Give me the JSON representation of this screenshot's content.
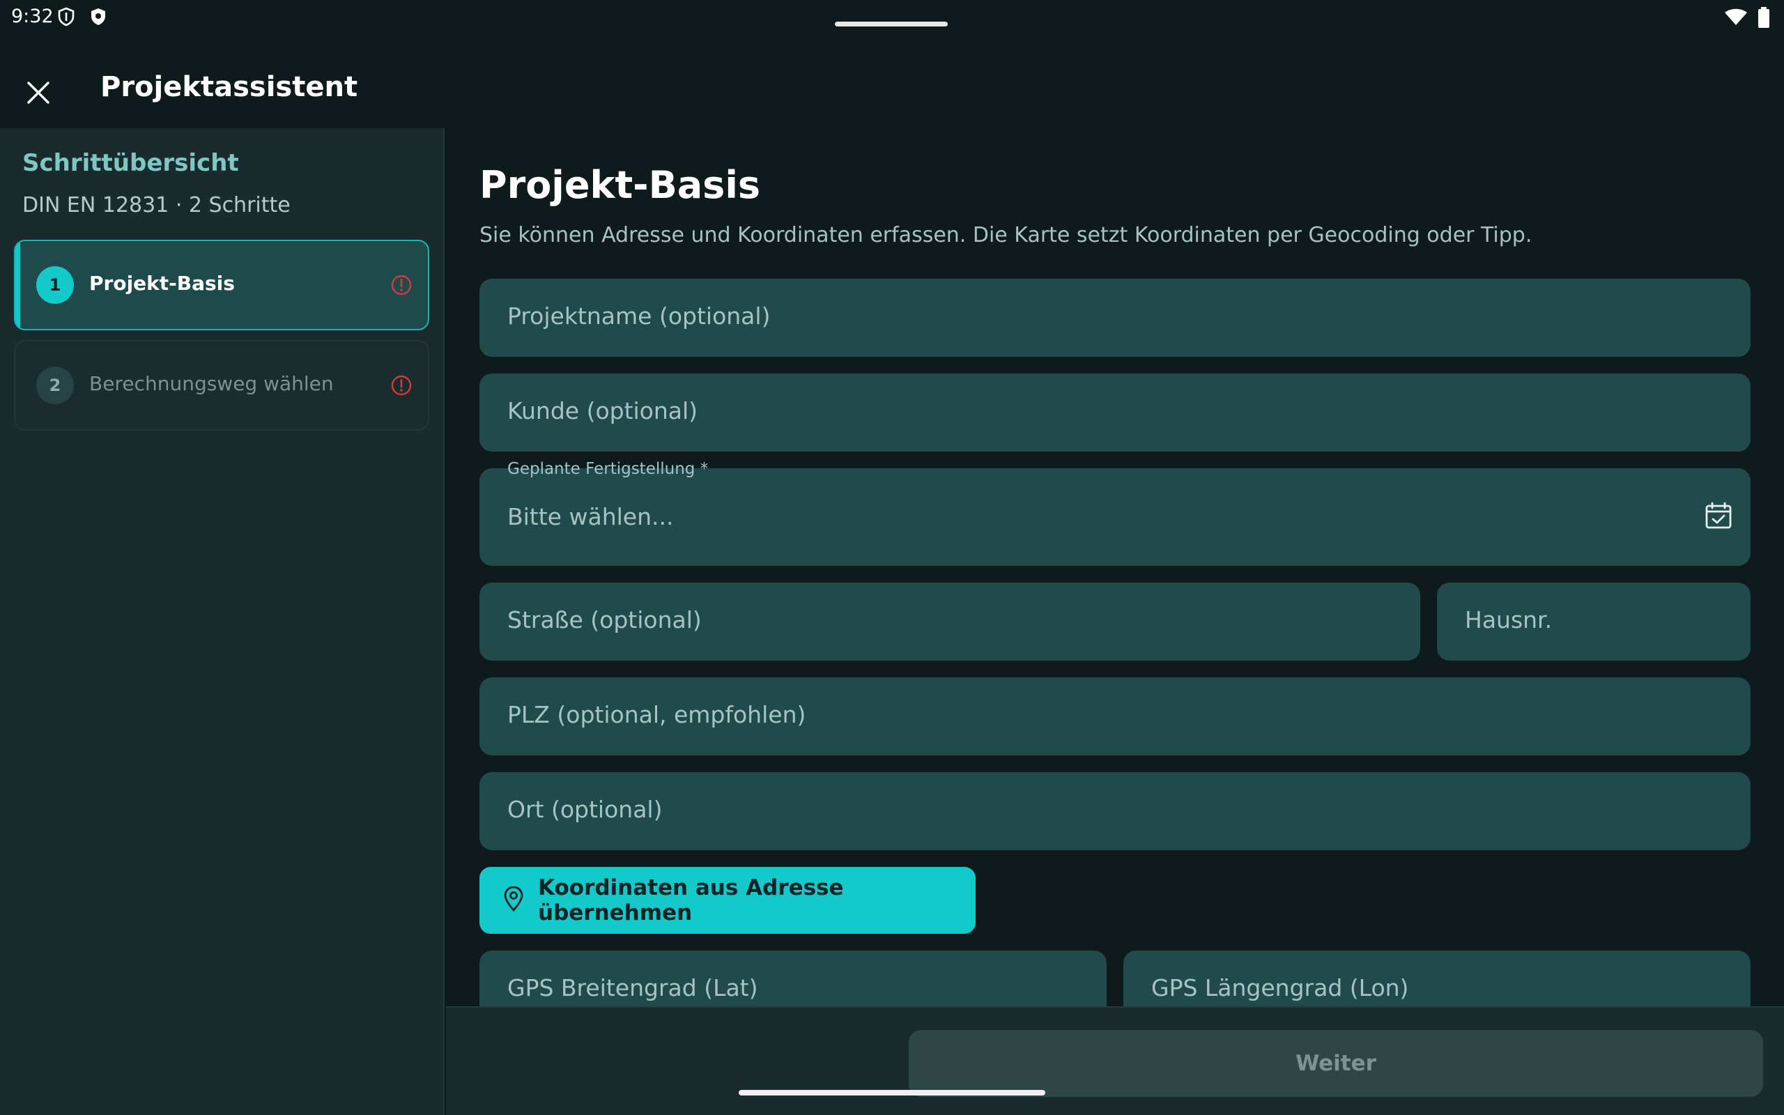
{
  "status": {
    "time": "9:32",
    "left_icons": [
      "shield-outline-icon",
      "shield-check-icon"
    ],
    "right_icons": [
      "wifi-icon",
      "battery-icon"
    ]
  },
  "appbar": {
    "close_icon": "close-icon",
    "title": "Projektassistent"
  },
  "sidebar": {
    "title": "Schrittübersicht",
    "subtitle": "DIN EN 12831 · 2 Schritte",
    "steps": [
      {
        "number": "1",
        "label": "Projekt-Basis",
        "active": true,
        "warning_icon": "error-circle-icon"
      },
      {
        "number": "2",
        "label": "Berechnungsweg wählen",
        "active": false,
        "warning_icon": "error-circle-icon"
      }
    ]
  },
  "main": {
    "title": "Projekt-Basis",
    "description": "Sie können Adresse und Koordinaten erfassen. Die Karte setzt Koordinaten per Geocoding oder Tipp.",
    "fields": {
      "project_name": {
        "placeholder": "Projektname (optional)"
      },
      "customer": {
        "placeholder": "Kunde (optional)"
      },
      "completion": {
        "label": "Geplante Fertigstellung *",
        "placeholder": "Bitte wählen...",
        "icon": "calendar-check-icon"
      },
      "street": {
        "placeholder": "Straße (optional)"
      },
      "house_number": {
        "placeholder": "Hausnr."
      },
      "zip": {
        "placeholder": "PLZ (optional, empfohlen)"
      },
      "city": {
        "placeholder": "Ort (optional)"
      },
      "lat": {
        "placeholder": "GPS Breitengrad (Lat)"
      },
      "lon": {
        "placeholder": "GPS Längengrad (Lon)"
      }
    },
    "coord_button": {
      "label": "Koordinaten aus Adresse übernehmen",
      "icon": "location-pin-icon"
    }
  },
  "footer": {
    "next_label": "Weiter"
  },
  "colors": {
    "accent": "#14c9c9",
    "background": "#0f1a1c",
    "sidebar": "#1a2b2e",
    "field": "#214a4b",
    "error": "#d23c3c"
  }
}
